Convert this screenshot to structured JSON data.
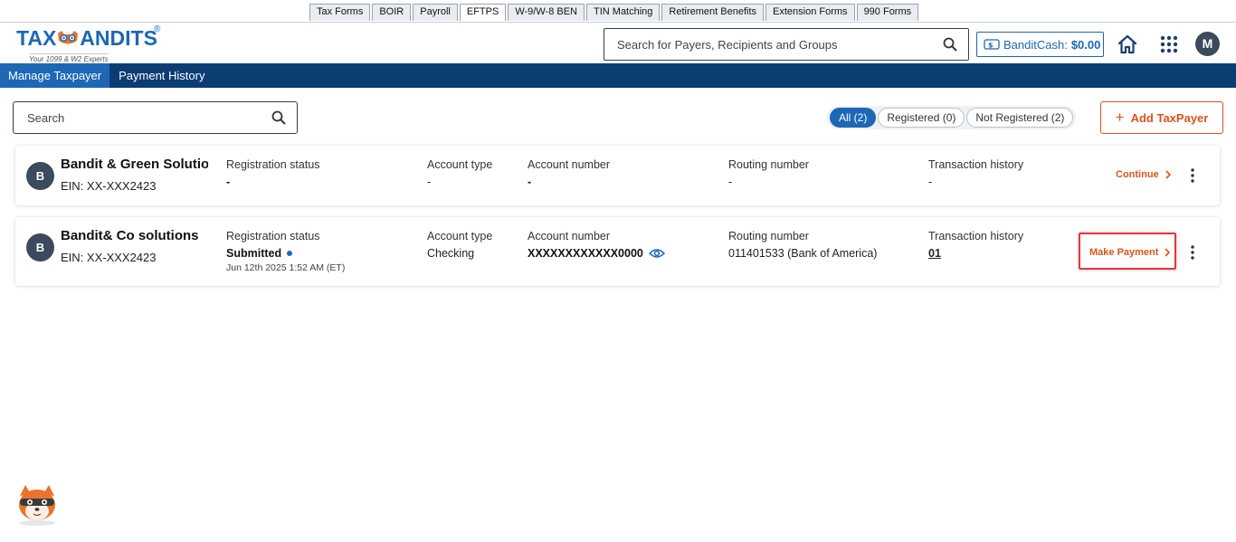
{
  "product_tabs": [
    {
      "label": "Tax Forms",
      "active": false
    },
    {
      "label": "BOIR",
      "active": false
    },
    {
      "label": "Payroll",
      "active": false
    },
    {
      "label": "EFTPS",
      "active": true
    },
    {
      "label": "W-9/W-8 BEN",
      "active": false
    },
    {
      "label": "TIN Matching",
      "active": false
    },
    {
      "label": "Retirement Benefits",
      "active": false
    },
    {
      "label": "Extension Forms",
      "active": false
    },
    {
      "label": "990 Forms",
      "active": false
    }
  ],
  "header": {
    "logo_text_left": "TAX",
    "logo_text_right": "ANDITS",
    "logo_tagline": "Your 1099 & W2 Experts",
    "search_placeholder": "Search for Payers, Recipients and Groups",
    "bandit_cash_label": "BanditCash:",
    "bandit_cash_amount": "$0.00",
    "user_initial": "M"
  },
  "nav": {
    "items": [
      {
        "label": "Manage Taxpayer",
        "active": true
      },
      {
        "label": "Payment History",
        "active": false
      }
    ]
  },
  "toolbar": {
    "search_placeholder": "Search",
    "filters": [
      {
        "label": "All (2)",
        "active": true
      },
      {
        "label": "Registered (0)",
        "active": false
      },
      {
        "label": "Not Registered (2)",
        "active": false
      }
    ],
    "add_button_label": "Add TaxPayer"
  },
  "taxpayers": [
    {
      "initial": "B",
      "name": "Bandit & Green Solutions",
      "ein": "EIN: XX-XXX2423",
      "registration_status_label": "Registration status",
      "registration_status": "-",
      "registration_date": "",
      "account_type_label": "Account type",
      "account_type": "-",
      "account_number_label": "Account number",
      "account_number": "-",
      "routing_number_label": "Routing number",
      "routing_number": "-",
      "transaction_history_label": "Transaction history",
      "transaction_history": "-",
      "action_label": "Continue"
    },
    {
      "initial": "B",
      "name": "Bandit& Co solutions",
      "ein": "EIN: XX-XXX2423",
      "registration_status_label": "Registration status",
      "registration_status": "Submitted",
      "registration_date": "Jun 12th 2025 1:52 AM (ET)",
      "account_type_label": "Account type",
      "account_type": "Checking",
      "account_number_label": "Account number",
      "account_number": "XXXXXXXXXXXX0000",
      "routing_number_label": "Routing number",
      "routing_number": "011401533 (Bank of America)",
      "transaction_history_label": "Transaction history",
      "transaction_history": "01",
      "action_label": "Make Payment"
    }
  ],
  "colors": {
    "brand_blue": "#1d67b5",
    "nav_dark": "#0b3d72",
    "accent_orange": "#d9531e",
    "highlight_red": "#e0373b"
  }
}
